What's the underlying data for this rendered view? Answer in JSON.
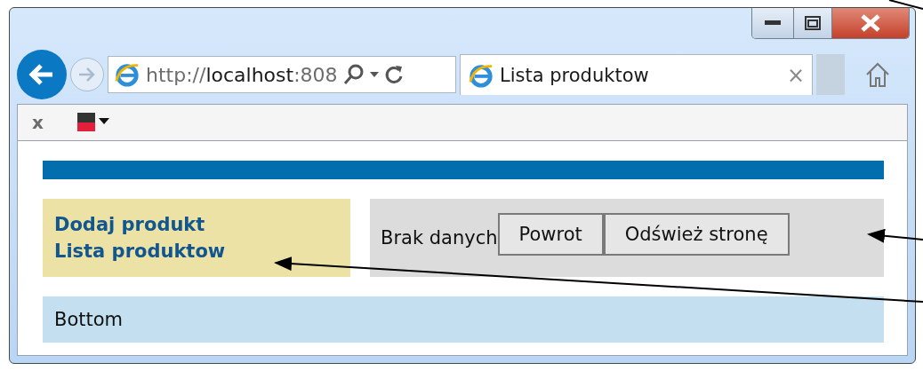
{
  "address_bar": {
    "scheme": "http://",
    "host": "localhost",
    "port": ":808"
  },
  "tab": {
    "title": "Lista produktow",
    "close": "×"
  },
  "toolbar": {
    "close": "x"
  },
  "page": {
    "menu": [
      "Dodaj produkt",
      "Lista produktow"
    ],
    "message": "Brak danych",
    "buttons": [
      "Powrot",
      "Odśwież stronę"
    ],
    "footer": "Bottom"
  }
}
